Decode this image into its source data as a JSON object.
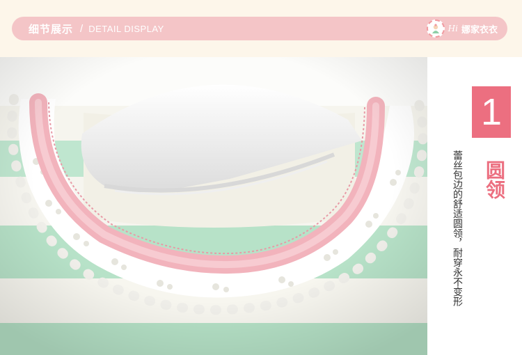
{
  "header": {
    "title_cn": "细节展示",
    "separator": "/",
    "title_en": "DETAIL DISPLAY",
    "brand_hi": "Hi",
    "brand_name": "娜家衣衣"
  },
  "feature": {
    "number": "1",
    "title": "圆领",
    "description": "蕾丝包边的舒适圆领，耐穿永不变形"
  },
  "colors": {
    "header_pill": "#f4c5c7",
    "accent_pink": "#ec6f80",
    "page_bg": "#fdf6ea",
    "stripe_green": "#b9e4cc",
    "collar_pink": "#f4b3bd"
  },
  "icons": {
    "brand_logo": "baby-logo-icon"
  }
}
